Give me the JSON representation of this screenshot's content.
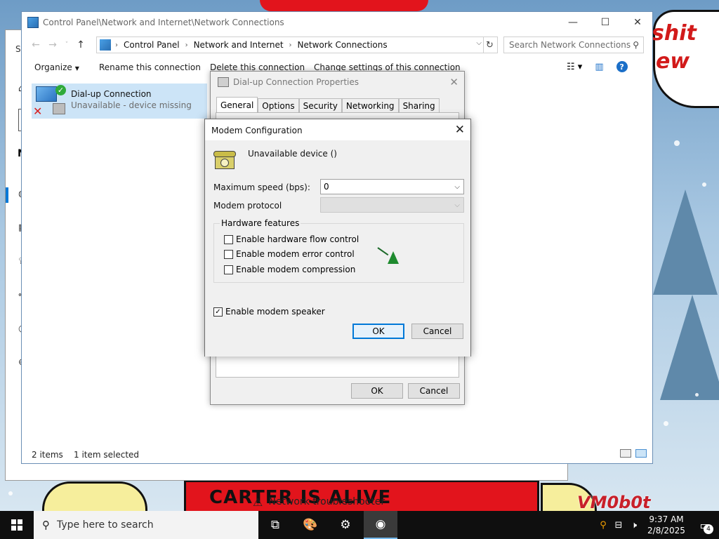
{
  "desktop": {
    "speech_text_1": "shit",
    "speech_text_2": "ew",
    "banner": "CARTER IS ALIVE",
    "watermark": "VM0b0t"
  },
  "settings_window": {
    "troubleshooter": "Network troubleshooter"
  },
  "explorer": {
    "title": "Control Panel\\Network and Internet\\Network Connections",
    "breadcrumbs": [
      "Control Panel",
      "Network and Internet",
      "Network Connections"
    ],
    "search_placeholder": "Search Network Connections",
    "commands": {
      "organize": "Organize",
      "rename": "Rename this connection",
      "delete": "Delete this connection",
      "change": "Change settings of this connection"
    },
    "item": {
      "name": "Dial-up Connection",
      "status": "Unavailable - device missing"
    },
    "status": {
      "count": "2 items",
      "selected": "1 item selected"
    }
  },
  "props_dialog": {
    "title": "Dial-up Connection Properties",
    "tabs": [
      "General",
      "Options",
      "Security",
      "Networking",
      "Sharing"
    ],
    "active_tab": "General",
    "ok": "OK",
    "cancel": "Cancel"
  },
  "modem_dialog": {
    "title": "Modem Configuration",
    "device": "Unavailable device ()",
    "max_speed_label": "Maximum speed (bps):",
    "max_speed_value": "0",
    "protocol_label": "Modem protocol",
    "protocol_value": "",
    "hw_group_label": "Hardware features",
    "checkboxes": [
      {
        "label": "Enable hardware flow control",
        "checked": false
      },
      {
        "label": "Enable modem error control",
        "checked": false
      },
      {
        "label": "Enable modem compression",
        "checked": false
      }
    ],
    "speaker": {
      "label": "Enable modem speaker",
      "checked": true
    },
    "ok": "OK",
    "cancel": "Cancel"
  },
  "taskbar": {
    "search_placeholder": "Type here to search",
    "time": "9:37 AM",
    "date": "2/8/2025",
    "notification_count": "4"
  }
}
